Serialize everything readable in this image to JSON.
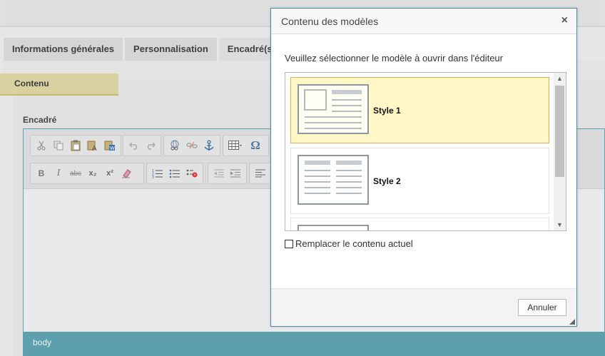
{
  "page": {
    "tabs": [
      {
        "label": "Informations générales"
      },
      {
        "label": "Personnalisation"
      },
      {
        "label": "Encadré(s)"
      }
    ],
    "content_tab": "Contenu",
    "section_label": "Encadré",
    "editor": {
      "toolbar_row2_labels": {
        "bold": "B",
        "italic": "I",
        "strike": "abc",
        "subscript": "x₂",
        "superscript": "x²"
      },
      "special_char": "Ω",
      "status_path": "body"
    }
  },
  "dialog": {
    "title": "Contenu des modèles",
    "close_glyph": "×",
    "instruction": "Veuillez sélectionner le modèle à ouvrir dans l'éditeur",
    "templates": [
      {
        "label": "Style 1",
        "selected": true
      },
      {
        "label": "Style 2",
        "selected": false
      }
    ],
    "replace_checkbox": {
      "label": "Remplacer le contenu actuel",
      "checked": false
    },
    "cancel_label": "Annuler"
  },
  "colors": {
    "selected_bg": "#fff8c6",
    "selected_border": "#e8aa55",
    "editor_status_bar": "#5e9fae",
    "content_tab": "#d9d2a0"
  }
}
